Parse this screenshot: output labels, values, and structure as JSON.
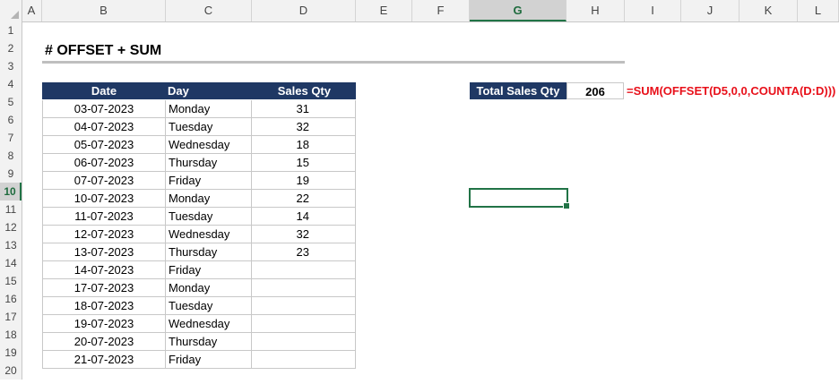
{
  "columns": [
    "A",
    "B",
    "C",
    "D",
    "E",
    "F",
    "G",
    "H",
    "I",
    "J",
    "K",
    "L"
  ],
  "rows": [
    "1",
    "2",
    "3",
    "4",
    "5",
    "6",
    "7",
    "8",
    "9",
    "10",
    "11",
    "12",
    "13",
    "14",
    "15",
    "16",
    "17",
    "18",
    "19",
    "20"
  ],
  "active_column": "G",
  "active_row": "10",
  "title": "# OFFSET + SUM",
  "table": {
    "headers": {
      "date": "Date",
      "day": "Day",
      "sales": "Sales Qty"
    },
    "rows": [
      {
        "date": "03-07-2023",
        "day": "Monday",
        "sales": "31"
      },
      {
        "date": "04-07-2023",
        "day": "Tuesday",
        "sales": "32"
      },
      {
        "date": "05-07-2023",
        "day": "Wednesday",
        "sales": "18"
      },
      {
        "date": "06-07-2023",
        "day": "Thursday",
        "sales": "15"
      },
      {
        "date": "07-07-2023",
        "day": "Friday",
        "sales": "19"
      },
      {
        "date": "10-07-2023",
        "day": "Monday",
        "sales": "22"
      },
      {
        "date": "11-07-2023",
        "day": "Tuesday",
        "sales": "14"
      },
      {
        "date": "12-07-2023",
        "day": "Wednesday",
        "sales": "32"
      },
      {
        "date": "13-07-2023",
        "day": "Thursday",
        "sales": "23"
      },
      {
        "date": "14-07-2023",
        "day": "Friday",
        "sales": ""
      },
      {
        "date": "17-07-2023",
        "day": "Monday",
        "sales": ""
      },
      {
        "date": "18-07-2023",
        "day": "Tuesday",
        "sales": ""
      },
      {
        "date": "19-07-2023",
        "day": "Wednesday",
        "sales": ""
      },
      {
        "date": "20-07-2023",
        "day": "Thursday",
        "sales": ""
      },
      {
        "date": "21-07-2023",
        "day": "Friday",
        "sales": ""
      }
    ]
  },
  "summary": {
    "label": "Total Sales Qty",
    "value": "206",
    "formula": "=SUM(OFFSET(D5,0,0,COUNTA(D:D)))"
  },
  "colors": {
    "header_fill": "#1f3864",
    "formula_text": "#e8101a",
    "selection": "#217346"
  }
}
